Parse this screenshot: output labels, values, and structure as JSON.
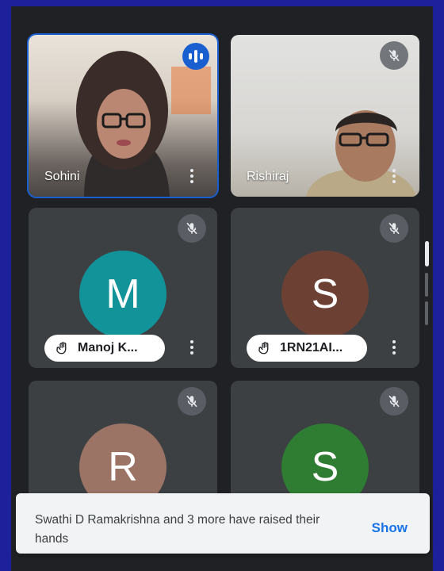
{
  "participants": [
    {
      "name": "Sohini",
      "type": "video",
      "speaking": true,
      "muted": false
    },
    {
      "name": "Rishiraj",
      "type": "video",
      "speaking": false,
      "muted": true
    },
    {
      "name": "Manoj K...",
      "initial": "M",
      "avatar_color": "#12939a",
      "hand_raised": true,
      "muted": true
    },
    {
      "name": "1RN21AI...",
      "initial": "S",
      "avatar_color": "#6d4034",
      "hand_raised": true,
      "muted": true
    },
    {
      "initial": "R",
      "avatar_color": "#9b7466",
      "muted": true
    },
    {
      "initial": "S",
      "avatar_color": "#2e7d32",
      "muted": true
    }
  ],
  "snackbar": {
    "message": "Swathi D Ramakrishna and 3 more have raised their hands",
    "action": "Show"
  },
  "colors": {
    "frame": "#1e1f9a",
    "background": "#202124",
    "tile": "#3c4043",
    "active_border": "#1a5fd0",
    "link": "#1a73e8"
  }
}
